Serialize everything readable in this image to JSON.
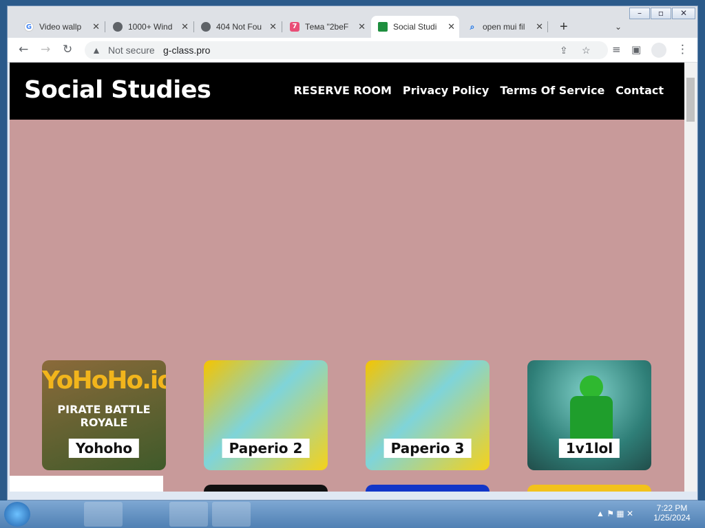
{
  "browser": {
    "tabs": [
      {
        "title": "Video wallp"
      },
      {
        "title": "1000+ Wind"
      },
      {
        "title": "404 Not Fou"
      },
      {
        "title": "Тема \"2beF"
      },
      {
        "title": "Social Studi"
      },
      {
        "title": "open mui fil"
      }
    ],
    "security": "Not secure",
    "url": "g-class.pro"
  },
  "site": {
    "brand": "Social Studies",
    "nav": [
      "RESERVE ROOM",
      "Privacy Policy",
      "Terms Of Service",
      "Contact"
    ]
  },
  "games": [
    {
      "name": "Yohoho",
      "art_text": "YoHoHo.io",
      "art_subtext": "PIRATE BATTLE ROYALE"
    },
    {
      "name": "Paperio 2"
    },
    {
      "name": "Paperio 3"
    },
    {
      "name": "1v1lol"
    }
  ],
  "taskbar": {
    "time": "7:22 PM",
    "date": "1/25/2024"
  },
  "colors": {
    "page_bg": "#c89a9a",
    "header_bg": "#000000"
  },
  "icons": [
    "google-icon",
    "globe-icon",
    "globe-icon",
    "2bef-icon",
    "classroom-icon",
    "search-icon"
  ]
}
